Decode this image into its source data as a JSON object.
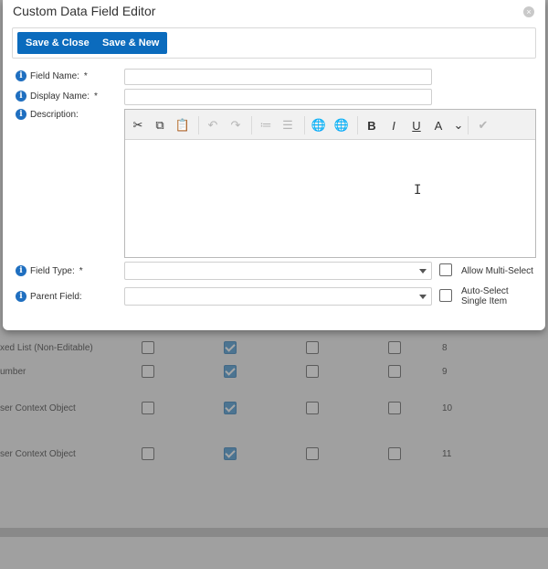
{
  "dialog": {
    "title": "Custom Data Field Editor",
    "close_glyph": "×",
    "buttons": {
      "save_close": "Save & Close",
      "save_new": "Save & New"
    }
  },
  "form": {
    "info_glyph": "i",
    "required_mark": "*",
    "field_name": {
      "label": "Field Name:",
      "value": "",
      "required": true
    },
    "display_name": {
      "label": "Display Name:",
      "value": "",
      "required": true
    },
    "description": {
      "label": "Description:"
    },
    "field_type": {
      "label": "Field Type:",
      "value": "",
      "required": true
    },
    "parent_field": {
      "label": "Parent Field:",
      "value": ""
    },
    "allow_multi_select": {
      "label": "Allow Multi-Select",
      "checked": false
    },
    "auto_select": {
      "label_line1": "Auto-Select",
      "label_line2": "Single Item",
      "checked": false
    }
  },
  "editor_toolbar": [
    {
      "name": "cut-icon",
      "glyph": "✂",
      "enabled": true
    },
    {
      "name": "copy-icon",
      "glyph": "⧉",
      "enabled": true
    },
    {
      "name": "paste-icon",
      "glyph": "📋",
      "enabled": false
    },
    {
      "name": "undo-icon",
      "glyph": "↶",
      "enabled": false
    },
    {
      "name": "redo-icon",
      "glyph": "↷",
      "enabled": false
    },
    {
      "name": "numbered-list-icon",
      "glyph": "≔",
      "enabled": false
    },
    {
      "name": "bullet-list-icon",
      "glyph": "☰",
      "enabled": false
    },
    {
      "name": "insert-link-icon",
      "glyph": "🌐",
      "enabled": true
    },
    {
      "name": "remove-link-icon",
      "glyph": "🌐",
      "enabled": false
    },
    {
      "name": "bold-icon",
      "glyph": "B",
      "enabled": true
    },
    {
      "name": "italic-icon",
      "glyph": "I",
      "enabled": true
    },
    {
      "name": "underline-icon",
      "glyph": "U",
      "enabled": true
    },
    {
      "name": "font-color-icon",
      "glyph": "A",
      "enabled": true
    },
    {
      "name": "dropdown-chevron-icon",
      "glyph": "⌄",
      "enabled": true
    },
    {
      "name": "spellcheck-icon",
      "glyph": "✔",
      "enabled": false
    }
  ],
  "background_rows": [
    {
      "label": "xed List (Non-Editable)",
      "checks": [
        false,
        true,
        false,
        false
      ],
      "num": "8"
    },
    {
      "label": "umber",
      "checks": [
        false,
        true,
        false,
        false
      ],
      "num": "9"
    },
    {
      "label": "ser Context Object",
      "checks": [
        false,
        true,
        false,
        false
      ],
      "num": "10"
    },
    {
      "label": "ser Context Object",
      "checks": [
        false,
        true,
        false,
        false
      ],
      "num": "11"
    }
  ],
  "colors": {
    "primary": "#0b6bbd",
    "info": "#1f6fc0",
    "checked_bg": "#5aa3d8"
  }
}
